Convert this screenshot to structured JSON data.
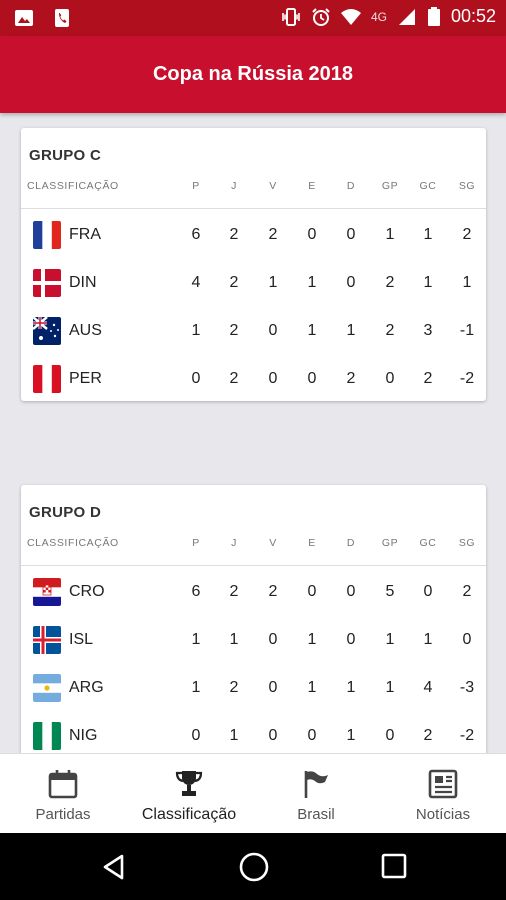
{
  "status_bar": {
    "time": "00:52",
    "network": "4G",
    "icons": [
      "image-icon",
      "phone-icon",
      "vibrate-icon",
      "alarm-icon",
      "wifi-icon",
      "signal-icon",
      "battery-icon"
    ]
  },
  "app_bar": {
    "title": "Copa na Rússia 2018"
  },
  "table_headers": {
    "classification": "CLASSIFICAÇÃO",
    "columns": [
      "P",
      "J",
      "V",
      "E",
      "D",
      "GP",
      "GC",
      "SG"
    ]
  },
  "groups": [
    {
      "title": "GRUPO C",
      "teams": [
        {
          "code": "FRA",
          "flag": "france",
          "stats": [
            "6",
            "2",
            "2",
            "0",
            "0",
            "1",
            "1",
            "2"
          ]
        },
        {
          "code": "DIN",
          "flag": "denmark",
          "stats": [
            "4",
            "2",
            "1",
            "1",
            "0",
            "2",
            "1",
            "1"
          ]
        },
        {
          "code": "AUS",
          "flag": "australia",
          "stats": [
            "1",
            "2",
            "0",
            "1",
            "1",
            "2",
            "3",
            "-1"
          ]
        },
        {
          "code": "PER",
          "flag": "peru",
          "stats": [
            "0",
            "2",
            "0",
            "0",
            "2",
            "0",
            "2",
            "-2"
          ]
        }
      ]
    },
    {
      "title": "GRUPO D",
      "teams": [
        {
          "code": "CRO",
          "flag": "croatia",
          "stats": [
            "6",
            "2",
            "2",
            "0",
            "0",
            "5",
            "0",
            "2"
          ]
        },
        {
          "code": "ISL",
          "flag": "iceland",
          "stats": [
            "1",
            "1",
            "0",
            "1",
            "0",
            "1",
            "1",
            "0"
          ]
        },
        {
          "code": "ARG",
          "flag": "argentina",
          "stats": [
            "1",
            "2",
            "0",
            "1",
            "1",
            "1",
            "4",
            "-3"
          ]
        },
        {
          "code": "NIG",
          "flag": "nigeria",
          "stats": [
            "0",
            "1",
            "0",
            "0",
            "1",
            "0",
            "2",
            "-2"
          ]
        }
      ]
    }
  ],
  "bottom_nav": [
    {
      "label": "Partidas",
      "icon": "calendar-icon",
      "active": false
    },
    {
      "label": "Classificação",
      "icon": "trophy-icon",
      "active": true
    },
    {
      "label": "Brasil",
      "icon": "flag-icon",
      "active": false
    },
    {
      "label": "Notícias",
      "icon": "newspaper-icon",
      "active": false
    }
  ],
  "colors": {
    "primary": "#c8102e",
    "status_bar": "#b0101e",
    "background": "#e8e8ec"
  }
}
